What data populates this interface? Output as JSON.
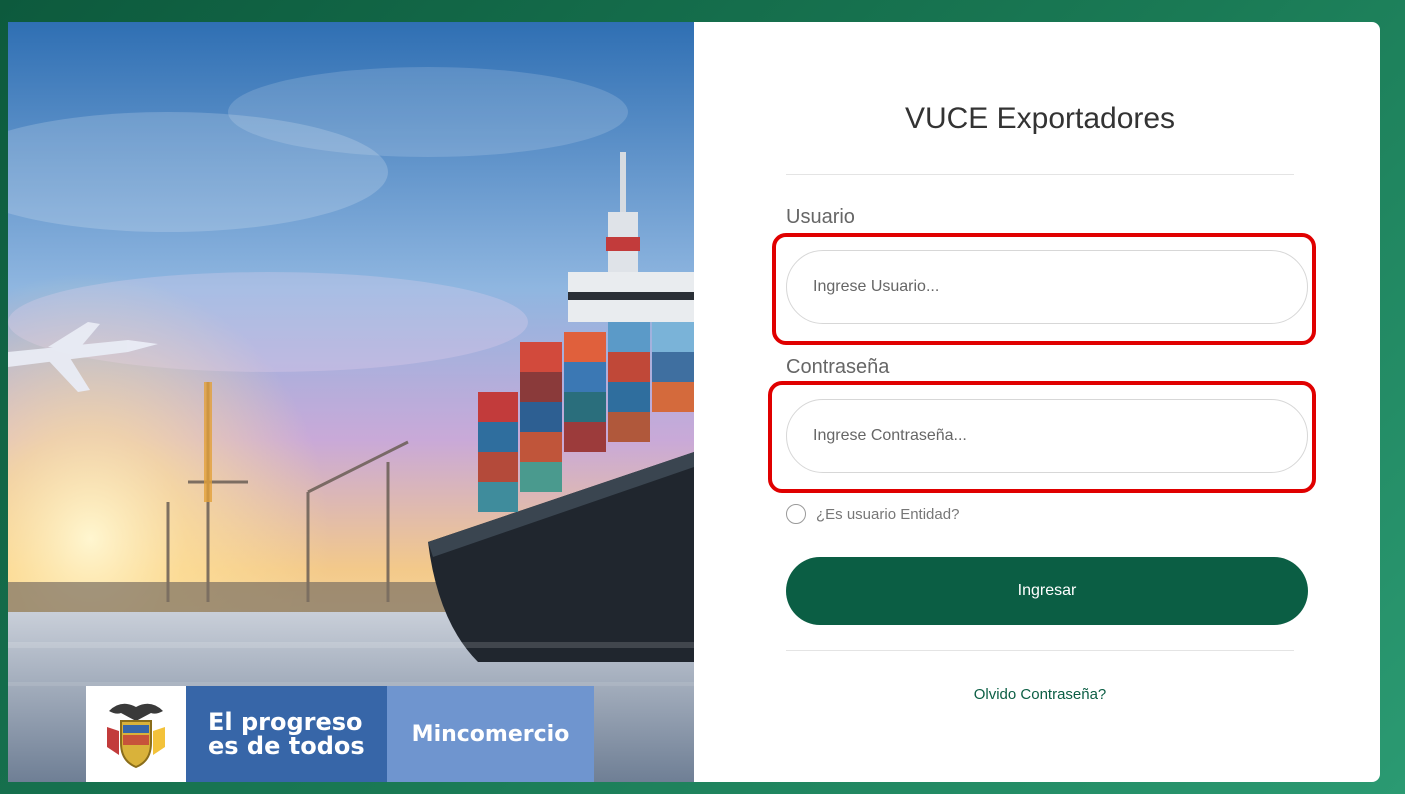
{
  "brand": {
    "slogan_line1": "El progreso",
    "slogan_line2": "es de todos",
    "ministry": "Mincomercio"
  },
  "login": {
    "title": "VUCE Exportadores",
    "username_label": "Usuario",
    "username_placeholder": "Ingrese Usuario...",
    "password_label": "Contraseña",
    "password_placeholder": "Ingrese Contraseña...",
    "entity_checkbox_label": "¿Es usuario Entidad?",
    "entity_checkbox_checked": false,
    "submit_label": "Ingresar",
    "forgot_label": "Olvido Contraseña?"
  },
  "colors": {
    "accent": "#0b5e44",
    "highlight": "#e00000",
    "brand_blue": "#3766a8",
    "brand_light_blue": "#6f95cf"
  }
}
